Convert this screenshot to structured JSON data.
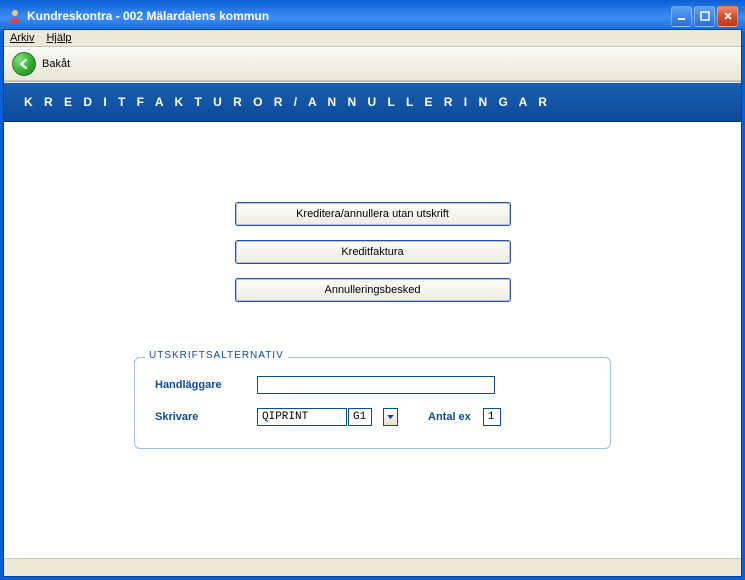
{
  "window": {
    "title": "Kundreskontra  -  002 Mälardalens kommun"
  },
  "menubar": {
    "arkiv": "Arkiv",
    "hjalp": "Hjälp"
  },
  "toolbar": {
    "back_label": "Bakåt"
  },
  "page": {
    "header": "K R E D I T F A K T U R O R / A N N U L L E R I N G A R"
  },
  "buttons": {
    "kreditera": "Kreditera/annullera utan utskrift",
    "kreditfaktura": "Kreditfaktura",
    "annullering": "Annulleringsbesked"
  },
  "fieldset": {
    "legend": "UTSKRIFTSALTERNATIV",
    "handlaggare_label": "Handläggare",
    "handlaggare_value": "",
    "skrivare_label": "Skrivare",
    "skrivare_value": "QIPRINT",
    "g1_value": "G1",
    "antal_label": "Antal ex",
    "antal_value": "1"
  }
}
